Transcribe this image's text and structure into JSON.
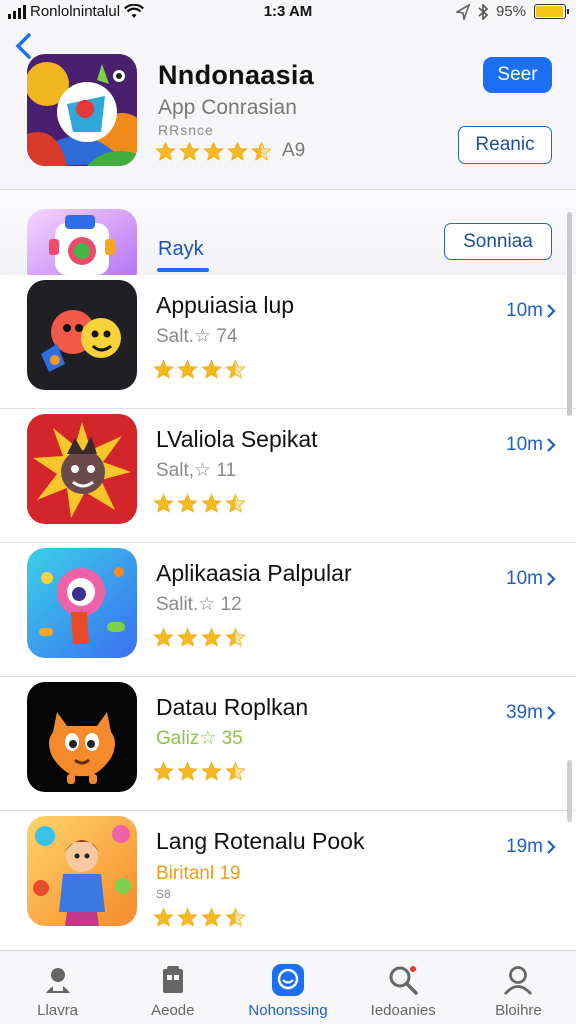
{
  "status_bar": {
    "carrier": "Ronlolnintalul",
    "time": "1:3 AM",
    "battery": "95%",
    "battery_level": 0.95
  },
  "header": {
    "title": "Nndonaasia",
    "subtitle": "App Conrasian",
    "meta": "RRsnce",
    "rating_text": "A9",
    "rating_stars": 4.5,
    "primary_button": "Seer",
    "secondary_button": "Reanic"
  },
  "segment": {
    "label": "Rayk",
    "sort_button": "Sonniaa"
  },
  "apps": [
    {
      "name": "Appuiasia lup",
      "category": "Salt.☆ 74",
      "size": "10m",
      "stars": 3.5,
      "category_color": "#8a8a8a"
    },
    {
      "name": "LValiola Sepikat",
      "category": "Salt,☆ 11",
      "size": "10m",
      "stars": 3.5,
      "category_color": "#8a8a8a"
    },
    {
      "name": "Aplikaasia Palpular",
      "category": "Salit.☆ 12",
      "size": "10m",
      "stars": 3.5,
      "category_color": "#8a8a8a"
    },
    {
      "name": "Datau Roplkan",
      "category": "Galiz☆ 35",
      "size": "39m",
      "stars": 3.5,
      "category_color": "#8bc34a"
    },
    {
      "name": "Lang Rotenalu Pook",
      "category": "Biritanl 19",
      "category_extra": "S8",
      "size": "19m",
      "stars": 3.5,
      "category_color": "#f39a18"
    }
  ],
  "tabs": [
    {
      "label": "Llavra",
      "icon": "person-badge-icon",
      "active": false
    },
    {
      "label": "Aeode",
      "icon": "store-icon",
      "active": false
    },
    {
      "label": "Nohonssing",
      "icon": "apps-icon",
      "active": true
    },
    {
      "label": "Iedoanies",
      "icon": "search-icon",
      "active": false
    },
    {
      "label": "Bloihre",
      "icon": "profile-icon",
      "active": false
    }
  ],
  "colors": {
    "accent": "#1b6ff0",
    "star": "#f5b921",
    "link": "#1d5fc4"
  }
}
